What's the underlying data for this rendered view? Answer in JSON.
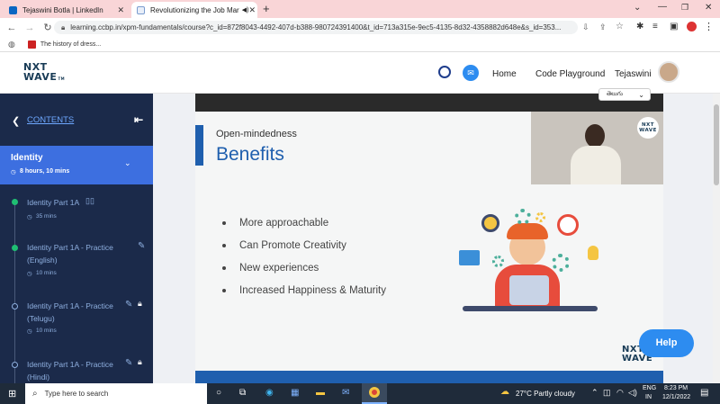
{
  "browser": {
    "tabs": [
      {
        "title": "Tejaswini Botla | LinkedIn",
        "active": false
      },
      {
        "title": "Revolutionizing the Job Mar",
        "active": true
      }
    ],
    "new_tab": "+",
    "url": "learning.ccbp.in/xpm-fundamentals/course?c_id=872f8043-4492-407d-b388-980724391400&t_id=713a315e-9ec5-4135-8d32-4358882d648e&s_id=353...",
    "bookmark": "The history of dress..."
  },
  "app": {
    "logo_top": "NXT",
    "logo_bottom": "WAVE",
    "logo_tm": "TM",
    "nav": [
      "Home",
      "Code Playground"
    ],
    "user_name": "Tejaswini"
  },
  "sidebar": {
    "contents_label": "CONTENTS",
    "section_title": "Identity",
    "section_duration": "8 hours, 10 mins",
    "items": [
      {
        "title_lines": [
          "Identity Part 1A"
        ],
        "mins": "35 mins",
        "status": "done",
        "locked": false
      },
      {
        "title_lines": [
          "Identity Part 1A - Practice",
          "(English)"
        ],
        "mins": "10 mins",
        "status": "done",
        "locked": false
      },
      {
        "title_lines": [
          "Identity Part 1A - Practice",
          "(Telugu)"
        ],
        "mins": "10 mins",
        "status": "todo",
        "locked": true
      },
      {
        "title_lines": [
          "Identity Part 1A - Practice",
          "(Hindi)"
        ],
        "mins": "",
        "status": "todo",
        "locked": true
      }
    ]
  },
  "slide": {
    "language_select": "తెలుగు",
    "subtitle": "Open-mindedness",
    "title": "Benefits",
    "bullets": [
      "More approachable",
      "Can Promote Creativity",
      "New experiences",
      "Increased Happiness & Maturity"
    ],
    "watermark_top": "NXT",
    "watermark_bottom": "WAVE",
    "video_badge_top": "NXT",
    "video_badge_bottom": "WAVE"
  },
  "help_button": "Help",
  "taskbar": {
    "search_placeholder": "Type here to search",
    "weather": "27°C  Partly cloudy",
    "lang_top": "ENG",
    "lang_bottom": "IN",
    "time": "8:23 PM",
    "date": "12/1/2022"
  },
  "colors": {
    "sidebar": "#1b2a4a",
    "active_section": "#3d6fe0",
    "accent_blue": "#1f5fae",
    "done_green": "#1fbf73"
  }
}
